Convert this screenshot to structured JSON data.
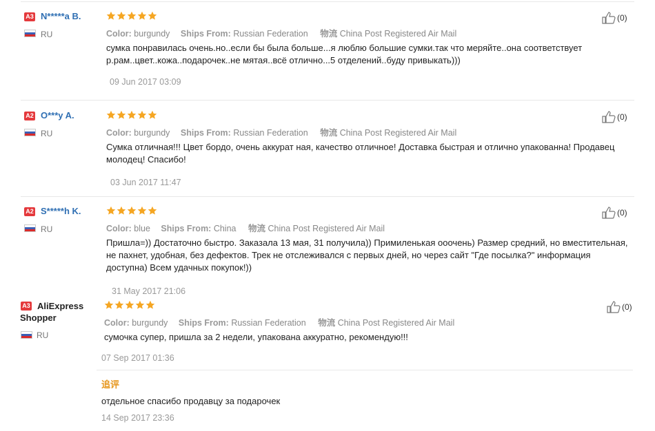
{
  "labels": {
    "color": "Color:",
    "ships_from": "Ships From:",
    "shipping_cn": "物流",
    "append_title": "追评"
  },
  "star_color": "#f5a623",
  "link_color": "#2f6fb3",
  "badge_color": "#e4393c",
  "reviews": [
    {
      "level": "A3",
      "name": "N*****a B.",
      "country": "RU",
      "stars": 5,
      "color": "burgundy",
      "ships_from": "Russian Federation",
      "shipping": "China Post Registered Air Mail",
      "text": "сумка понравилась очень.но..если бы была больше...я люблю большие сумки.так что меряйте..она соответствует р.рам..цвет..кожа..подарочек..не мятая..всё отлично...5 отделений..буду привыкать)))",
      "date": "09 Jun 2017 03:09",
      "helpful": "(0)"
    },
    {
      "level": "A2",
      "name": "O***y A.",
      "country": "RU",
      "stars": 5,
      "color": "burgundy",
      "ships_from": "Russian Federation",
      "shipping": "China Post Registered Air Mail",
      "text": "Сумка отличная!!! Цвет бордо, очень аккурат ная, качество отличное! Доставка быстрая и отлично упакованна! Продавец молодец! Спасибо!",
      "date": "03 Jun 2017 11:47",
      "helpful": "(0)"
    },
    {
      "level": "A2",
      "name": "S*****h K.",
      "country": "RU",
      "stars": 5,
      "color": "blue",
      "ships_from": "China",
      "shipping": "China Post Registered Air Mail",
      "text": "Пришла=)) Достаточно быстро. Заказала 13 мая, 31 получила)) Примиленькая ооочень) Размер средний, но вместительная, не пахнет, удобная, без дефектов. Трек не отслеживался с первых дней, но через сайт \"Где посылка?\" информация доступна) Всем удачных покупок!))",
      "date": "31 May 2017 21:06",
      "helpful": "(0)"
    },
    {
      "level": "A3",
      "name": "AliExpress Shopper",
      "country": "RU",
      "stars": 5,
      "color": "burgundy",
      "ships_from": "Russian Federation",
      "shipping": "China Post Registered Air Mail",
      "text": "сумочка супер, пришла за 2 недели, упакована аккуратно, рекомендую!!!",
      "date": "07 Sep 2017 01:36",
      "helpful": "(0)",
      "append_text": "отдельное спасибо продавцу за подарочек",
      "append_date": "14 Sep 2017 23:36"
    }
  ]
}
